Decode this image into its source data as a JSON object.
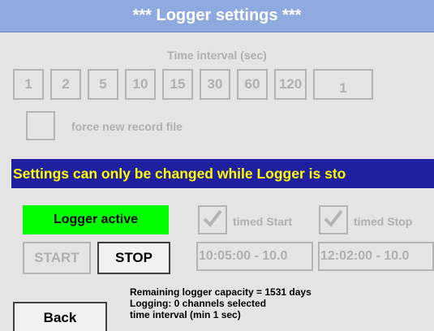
{
  "title": "***  Logger settings  ***",
  "interval_label": "Time interval (sec)",
  "intervals": [
    "1",
    "2",
    "5",
    "10",
    "15",
    "30",
    "60",
    "120"
  ],
  "custom_interval": "1",
  "force_label": "force new record file",
  "warning": "Settings can only be changed while Logger is sto",
  "status": "Logger active",
  "start_label": "START",
  "stop_label": "STOP",
  "timed_start_label": "timed Start",
  "timed_stop_label": "timed Stop",
  "start_time": "10:05:00 - 10.0",
  "stop_time": "12:02:00 - 10.0",
  "info": {
    "line1": "Remaining logger capacity = 1531 days",
    "line2": "Logging: 0 channels selected",
    "line3": "time interval (min 1 sec)"
  },
  "back_label": "Back",
  "colors": {
    "title_bg": "#8eaadf",
    "warning_bg": "#1f1fa0",
    "warning_text": "#ffff00",
    "status_bg": "#00ff00",
    "disabled_text": "#b0b0b0"
  },
  "icons": {
    "check": "check-icon"
  }
}
